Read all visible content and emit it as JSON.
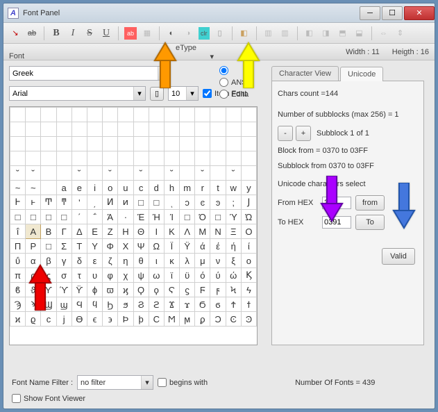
{
  "titlebar": {
    "icon_letter": "A",
    "title": "Font Panel"
  },
  "toolbar": {
    "arrow_icon": "↘",
    "ab": "ab",
    "b": "B",
    "i": "I",
    "s": "S",
    "u": "U",
    "ab_box": "ab",
    "clr": "clr",
    "eraser": "◧"
  },
  "status": {
    "font_type_label": "eType Font",
    "width_label": "Width : 11",
    "height_label": "Heigth : 16"
  },
  "dropdowns": {
    "script": "Greek",
    "font": "Arial",
    "size": "10"
  },
  "radios": {
    "opt1": "",
    "opt2": "ANSI",
    "opt3": "Edita"
  },
  "item_font_label": "Item Font",
  "tabs": {
    "char_view": "Character View",
    "unicode": "Unicode"
  },
  "panel": {
    "chars_count": "Chars count =144",
    "subblocks_label": "Number of subblocks (max 256)  = 1",
    "subblock_of": "Subblock 1 of 1",
    "block_from": "Block from = 0370 to 03FF",
    "subblock_from": "Subblock from 0370 to 03FF",
    "unicode_select": "Unicode characters select",
    "from_hex_label": "From HEX",
    "from_hex_val": "391",
    "from_btn": "from",
    "to_hex_label": "To HEX",
    "to_hex_val": "0391",
    "to_btn": "To",
    "valid_btn": "Valid"
  },
  "filter": {
    "label": "Font Name Filter :",
    "value": "no filter",
    "begins_with": "begins with",
    "num_fonts": "Number Of Fonts = 439"
  },
  "show_viewer": "Show Font Viewer",
  "grid_rows": [
    [
      "Ͱ",
      "ͱ",
      "Ͳ",
      "ͳ",
      "ʹ",
      "͵",
      "Ͷ",
      "ͷ",
      "□",
      "□",
      "ͺ",
      "ͻ",
      "ͼ",
      "ͽ",
      ";",
      "Ϳ"
    ],
    [
      "□",
      "□",
      "□",
      "□",
      "΄",
      "΅",
      "Ά",
      "·",
      "Έ",
      "Ή",
      "Ί",
      "□",
      "Ό",
      "□",
      "Ύ",
      "Ώ"
    ],
    [
      "ΐ",
      "Α",
      "Β",
      "Γ",
      "Δ",
      "Ε",
      "Ζ",
      "Η",
      "Θ",
      "Ι",
      "Κ",
      "Λ",
      "Μ",
      "Ν",
      "Ξ",
      "Ο"
    ],
    [
      "Π",
      "Ρ",
      "□",
      "Σ",
      "Τ",
      "Υ",
      "Φ",
      "Χ",
      "Ψ",
      "Ω",
      "Ϊ",
      "Ϋ",
      "ά",
      "έ",
      "ή",
      "ί"
    ],
    [
      "ΰ",
      "α",
      "β",
      "γ",
      "δ",
      "ε",
      "ζ",
      "η",
      "θ",
      "ι",
      "κ",
      "λ",
      "μ",
      "ν",
      "ξ",
      "ο"
    ],
    [
      "π",
      "ρ",
      "ς",
      "σ",
      "τ",
      "υ",
      "φ",
      "χ",
      "ψ",
      "ω",
      "ϊ",
      "ϋ",
      "ό",
      "ύ",
      "ώ",
      "Ϗ"
    ],
    [
      "ϐ",
      "ϑ",
      "ϒ",
      "ϓ",
      "ϔ",
      "ϕ",
      "ϖ",
      "ϗ",
      "Ϙ",
      "ϙ",
      "Ϛ",
      "ϛ",
      "Ϝ",
      "ϝ",
      "Ϟ",
      "ϟ"
    ],
    [
      "Ϡ",
      "ϡ",
      "Ϣ",
      "ϣ",
      "Ϥ",
      "ϥ",
      "Ϧ",
      "ϧ",
      "Ϩ",
      "ϩ",
      "Ϫ",
      "ϫ",
      "Ϭ",
      "ϭ",
      "Ϯ",
      "ϯ"
    ],
    [
      "ϰ",
      "ϱ",
      "ϲ",
      "ϳ",
      "ϴ",
      "ϵ",
      "϶",
      "Ϸ",
      "ϸ",
      "Ϲ",
      "Ϻ",
      "ϻ",
      "ϼ",
      "Ͻ",
      "Ͼ",
      "Ͽ"
    ]
  ],
  "grid_blank_top_rows": 6,
  "selected_cell": {
    "row": 2,
    "col": 1
  },
  "annotations": {
    "orange": {
      "color": "#ff9900",
      "stroke": "#b36b00"
    },
    "yellow": {
      "color": "#ffff00",
      "stroke": "#cccc00"
    },
    "purple": {
      "color": "#aa00ff",
      "stroke": "#6600aa"
    },
    "blue": {
      "color": "#4477dd",
      "stroke": "#2255aa"
    },
    "red": {
      "color": "#ee0000",
      "stroke": "#aa0000"
    }
  }
}
